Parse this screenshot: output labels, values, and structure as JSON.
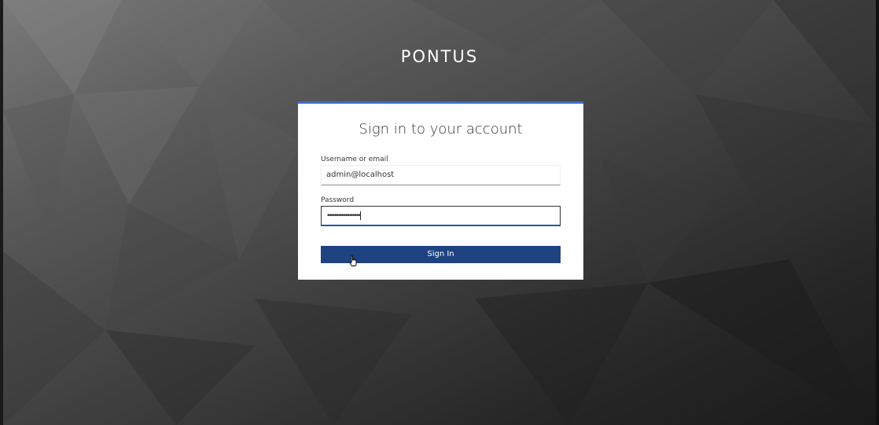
{
  "brand": {
    "title": "PONTUS"
  },
  "login": {
    "heading": "Sign in to your account",
    "username": {
      "label": "Username or email",
      "value": "admin@localhost"
    },
    "password": {
      "label": "Password",
      "masked_value": "••••••••••••••••••"
    },
    "submit_label": "Sign In"
  },
  "colors": {
    "accent": "#3b6fc4",
    "button": "#1f4281"
  },
  "icons": {
    "cursor": "hand-pointer-icon"
  }
}
